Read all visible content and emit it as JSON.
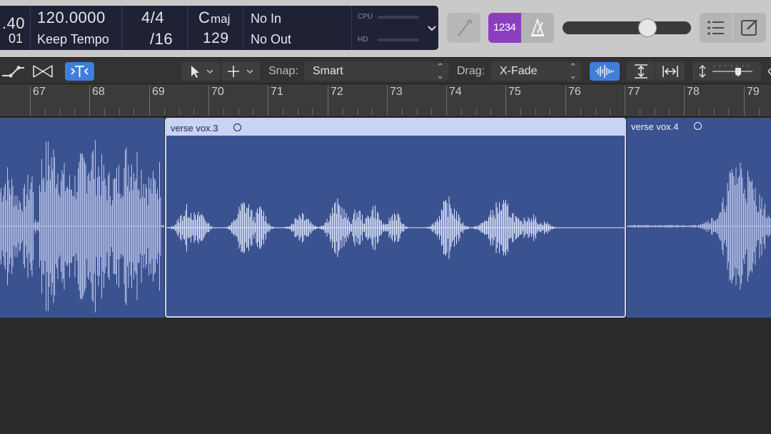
{
  "lcd": {
    "position_bar": ".40",
    "position_beat": "01",
    "tempo": "120.0000",
    "tempo_mode": "Keep Tempo",
    "signature": "4/4",
    "division": "/16",
    "key_root": "C",
    "key_mode": "maj",
    "key_value": "129",
    "midi_in": "No In",
    "midi_out": "No Out",
    "cpu_label": "CPU",
    "hd_label": "HD"
  },
  "control_bar": {
    "count_in_label": "1234",
    "volume_level": 0.69
  },
  "edit_toolbar": {
    "snap_label": "Snap:",
    "snap_value": "Smart",
    "drag_label": "Drag:",
    "drag_value": "X-Fade"
  },
  "ruler": {
    "bars": [
      "67",
      "68",
      "69",
      "70",
      "71",
      "72",
      "73",
      "74",
      "75",
      "76",
      "77",
      "78",
      "79"
    ]
  },
  "regions": [
    {
      "name": "",
      "selected": false
    },
    {
      "name": "verse vox.3",
      "selected": true
    },
    {
      "name": "verse vox.4",
      "selected": false
    }
  ],
  "colors": {
    "region_fill": "#3b5290",
    "region_selected_header": "#c9d3f4",
    "waveform": "#b9c4ea",
    "waveform_selected": "#dfe6fb",
    "count_in_accent": "#8a3fbf",
    "toolbar_active": "#3f7fd8",
    "lcd_background": "#1f2134"
  },
  "icons": {
    "automation": "automation-curve-icon",
    "flex": "flex-icon",
    "catch": "catch-playhead-icon",
    "pointer": "pointer-tool-icon",
    "crosshair": "crosshair-tool-icon",
    "waveform_zoom": "waveform-zoom-icon",
    "vertical_zoom": "vertical-zoom-icon",
    "horizontal_zoom": "horizontal-zoom-icon",
    "tuner": "tuner-icon",
    "metronome": "metronome-icon",
    "list_editors": "list-icon",
    "note_pad": "note-pad-icon"
  }
}
